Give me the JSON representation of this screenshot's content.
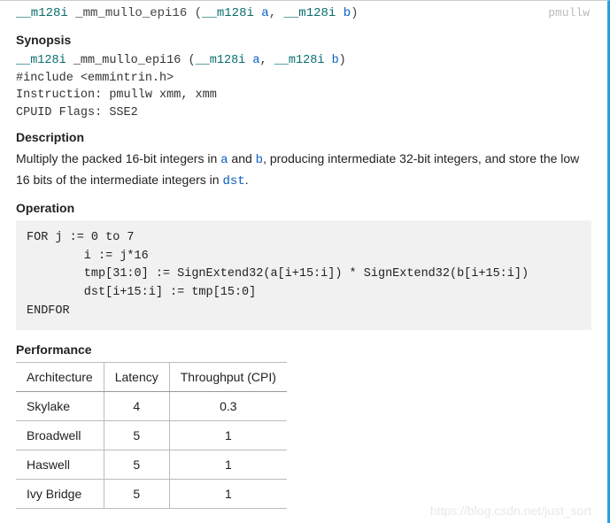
{
  "signature": {
    "ret_type": "__m128i",
    "func_name": "_mm_mullo_epi16",
    "open": "(",
    "p1_type": "__m128i",
    "p1_name": "a",
    "comma": ",",
    "p2_type": "__m128i",
    "p2_name": "b",
    "close": ")",
    "instr_tag": "pmullw"
  },
  "sections": {
    "synopsis": "Synopsis",
    "description": "Description",
    "operation": "Operation",
    "performance": "Performance"
  },
  "synopsis": {
    "sig_ret_type": "__m128i",
    "sig_func_name": "_mm_mullo_epi16",
    "sig_open": "(",
    "sig_p1_type": "__m128i",
    "sig_p1_name": "a",
    "sig_comma": ",",
    "sig_p2_type": "__m128i",
    "sig_p2_name": "b",
    "sig_close": ")",
    "include_line": "#include <emmintrin.h>",
    "instruction_line": "Instruction: pmullw xmm, xmm",
    "cpuid_line": "CPUID Flags: SSE2"
  },
  "description": {
    "text_1": "Multiply the packed 16-bit integers in ",
    "code_a": "a",
    "text_2": " and ",
    "code_b": "b",
    "text_3": ", producing intermediate 32-bit integers, and store the low 16 bits of the intermediate integers in ",
    "code_dst": "dst",
    "text_4": "."
  },
  "operation": "FOR j := 0 to 7\n        i := j*16\n        tmp[31:0] := SignExtend32(a[i+15:i]) * SignExtend32(b[i+15:i])\n        dst[i+15:i] := tmp[15:0]\nENDFOR",
  "perf_table": {
    "headers": [
      "Architecture",
      "Latency",
      "Throughput (CPI)"
    ],
    "rows": [
      {
        "arch": "Skylake",
        "latency": "4",
        "throughput": "0.3"
      },
      {
        "arch": "Broadwell",
        "latency": "5",
        "throughput": "1"
      },
      {
        "arch": "Haswell",
        "latency": "5",
        "throughput": "1"
      },
      {
        "arch": "Ivy Bridge",
        "latency": "5",
        "throughput": "1"
      }
    ]
  },
  "watermark": "https://blog.csdn.net/just_sort"
}
